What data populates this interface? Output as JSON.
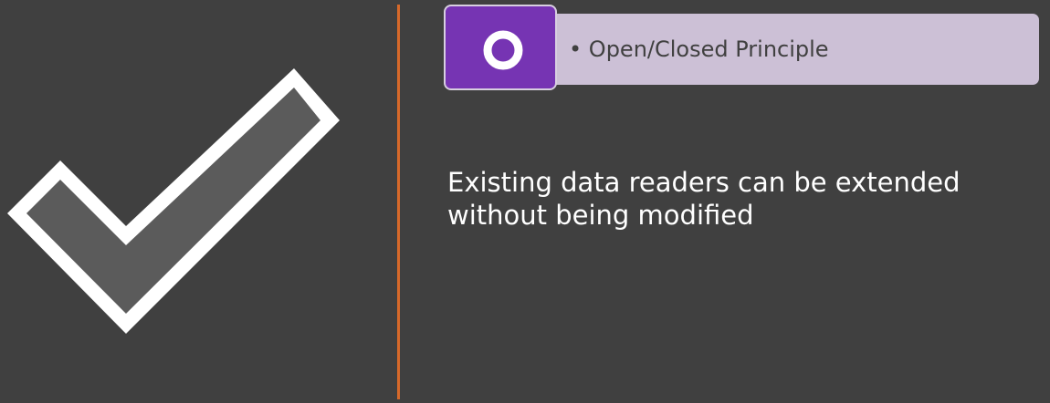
{
  "principle": {
    "letter": "O",
    "label": "Open/Closed Principle",
    "bullet": "•"
  },
  "statement": "Existing data readers can be extended without being modified",
  "colors": {
    "background": "#404040",
    "divider": "#d7692a",
    "letter_box": "#7634b3",
    "principle_bar": "#ccc0d6",
    "checkmark_fill": "#5b5b5b",
    "checkmark_outline": "#ffffff"
  },
  "icons": {
    "check": "checkmark-icon"
  }
}
